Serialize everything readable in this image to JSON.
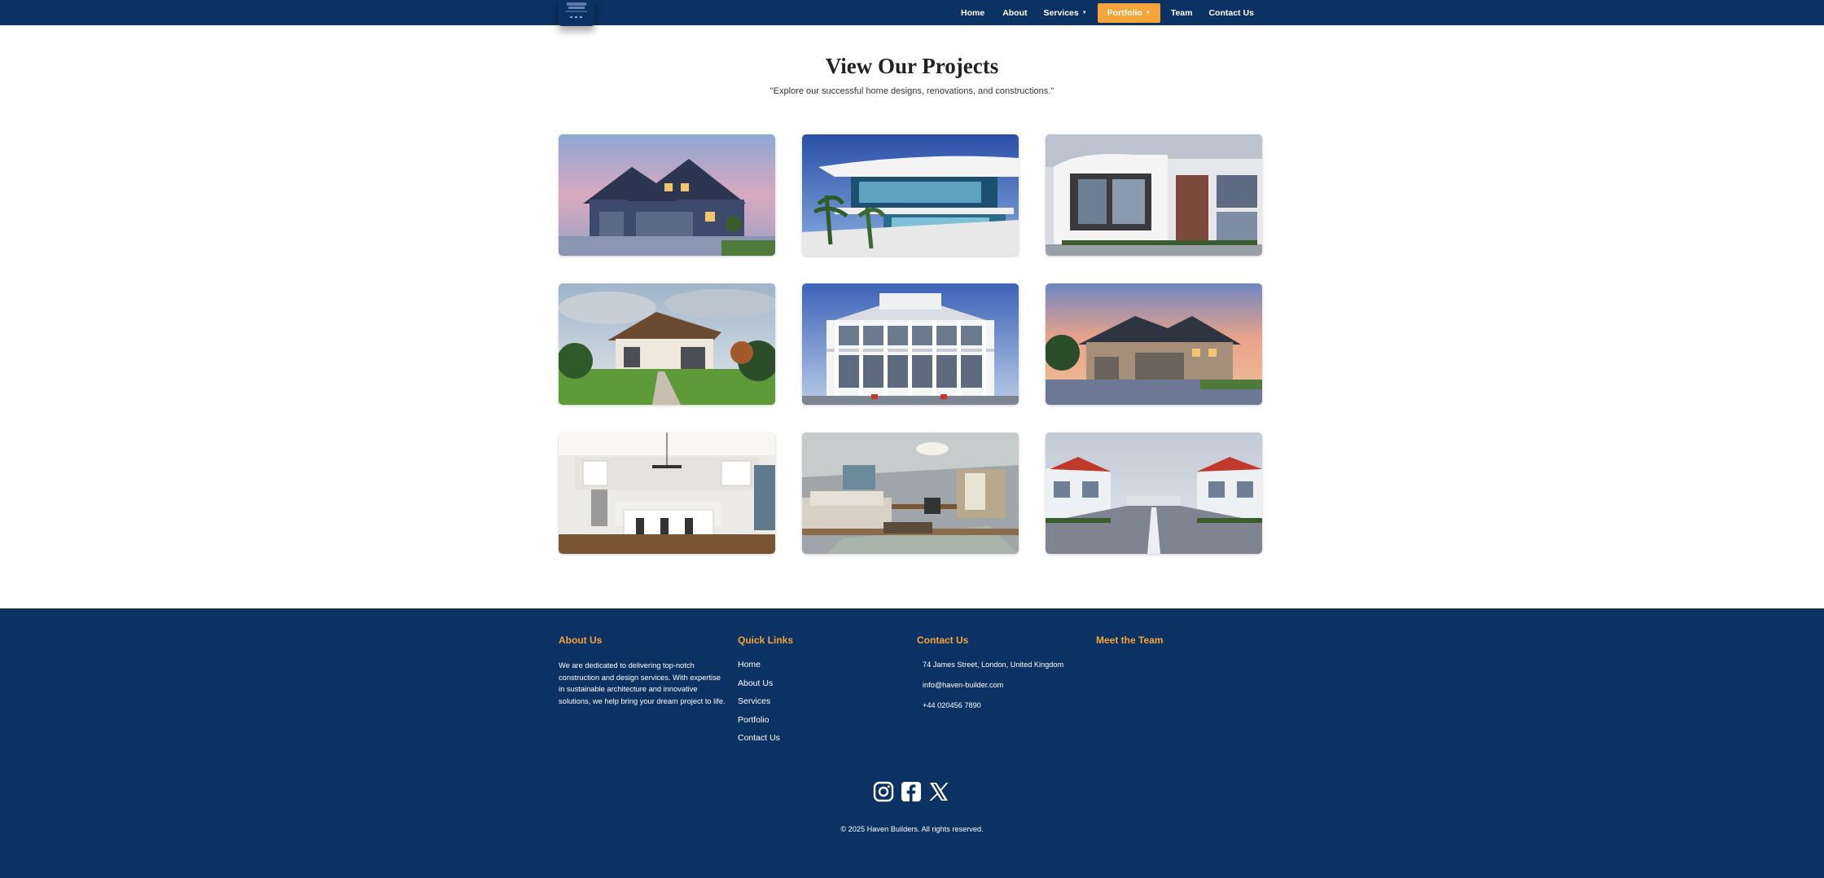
{
  "nav": {
    "logo": "logo-icon",
    "items": [
      {
        "label": "Home"
      },
      {
        "label": "About"
      },
      {
        "label": "Services"
      },
      {
        "label": "Portfolio"
      },
      {
        "label": "Team"
      },
      {
        "label": "Contact Us"
      }
    ],
    "active_color": "#f5a53a",
    "bg_color": "#0c3163"
  },
  "header": {
    "title": "View Our Projects",
    "subtitle": "\"Explore our successful home designs, renovations, and constructions.\""
  },
  "projects": [
    {
      "icon": "suburban-house-photo"
    },
    {
      "icon": "modern-glass-villa-photo"
    },
    {
      "icon": "modern-apartment-building-photo"
    },
    {
      "icon": "wooden-house-garden-photo"
    },
    {
      "icon": "colonial-porch-house-photo"
    },
    {
      "icon": "sunset-house-photo"
    },
    {
      "icon": "kitchen-interior-photo"
    },
    {
      "icon": "living-room-interior-photo"
    },
    {
      "icon": "residential-street-photo"
    }
  ],
  "footer": {
    "about": {
      "heading": "About Us",
      "text": "We are dedicated to delivering top-notch construction and design services. With expertise in sustainable architecture and innovative solutions, we help bring your dream project to life."
    },
    "quick_links": {
      "heading": "Quick Links",
      "items": [
        "Home",
        "About Us",
        "Services",
        "Portfolio",
        "Contact Us"
      ]
    },
    "contact": {
      "heading": "Contact Us",
      "address": "74 James Street, London, United Kingdom",
      "email": "info@haven-builder.com",
      "phone": "+44 020456 7890"
    },
    "team": {
      "heading": "Meet the Team"
    },
    "social": [
      "instagram-icon",
      "facebook-icon",
      "x-icon"
    ],
    "copyright": "© 2025 Haven Builders. All rights reserved.",
    "accent_color": "#f5a53a"
  }
}
